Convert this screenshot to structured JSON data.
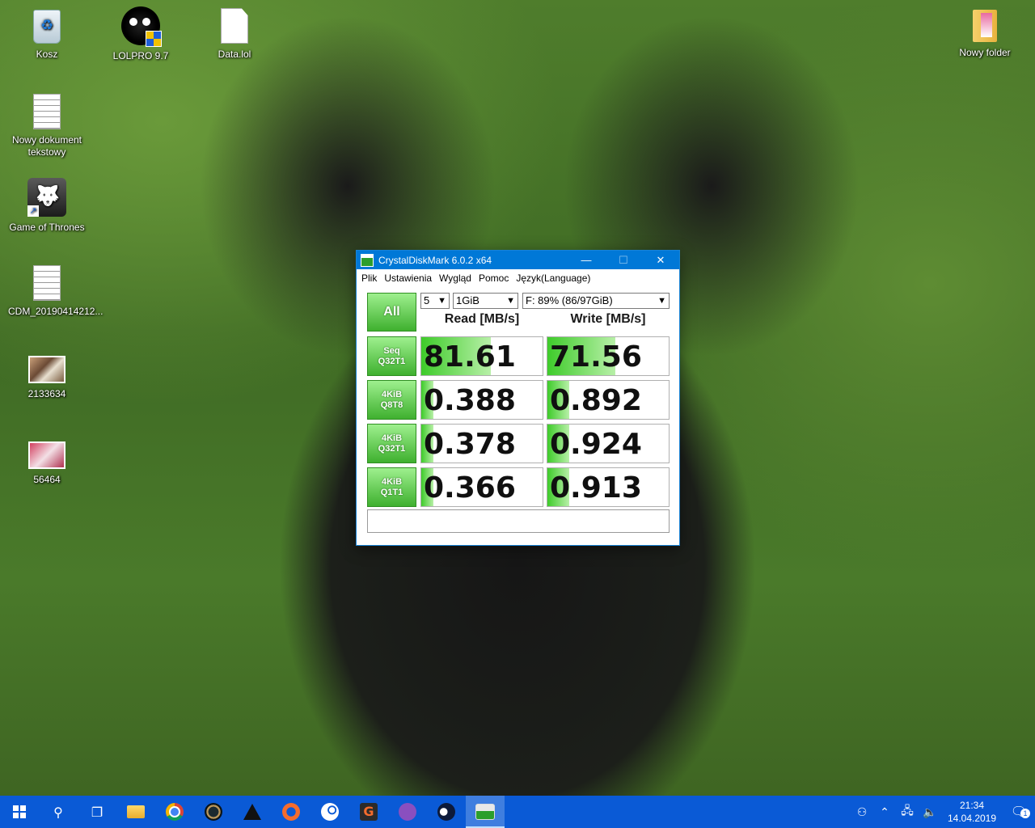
{
  "desktop": {
    "icons": [
      {
        "label": "Kosz",
        "icon": "recycle-bin-icon"
      },
      {
        "label": "LOLPRO 9.7",
        "icon": "lolpro-icon"
      },
      {
        "label": "Data.lol",
        "icon": "file-icon"
      },
      {
        "label": "Nowy folder",
        "icon": "folder-icon"
      },
      {
        "label": "Nowy dokument tekstowy",
        "icon": "text-document-icon"
      },
      {
        "label": "Game of Thrones",
        "icon": "shortcut-icon"
      },
      {
        "label": "CDM_20190414212...",
        "icon": "text-document-icon"
      },
      {
        "label": "2133634",
        "icon": "image-icon"
      },
      {
        "label": "56464",
        "icon": "image-icon"
      }
    ]
  },
  "window": {
    "title": "CrystalDiskMark 6.0.2 x64",
    "min_glyph": "—",
    "max_glyph": "☐",
    "close_glyph": "✕",
    "menu": [
      "Plik",
      "Ustawienia",
      "Wygląd",
      "Pomoc",
      "Język(Language)"
    ],
    "all_label": "All",
    "count": "5",
    "size": "1GiB",
    "drive": "F: 89% (86/97GiB)",
    "read_header": "Read [MB/s]",
    "write_header": "Write [MB/s]",
    "tests": [
      {
        "line1": "Seq",
        "line2": "Q32T1",
        "read": "81.61",
        "write": "71.56",
        "read_frac": 0.57,
        "write_frac": 0.56
      },
      {
        "line1": "4KiB",
        "line2": "Q8T8",
        "read": "0.388",
        "write": "0.892",
        "read_frac": 0.1,
        "write_frac": 0.18
      },
      {
        "line1": "4KiB",
        "line2": "Q32T1",
        "read": "0.378",
        "write": "0.924",
        "read_frac": 0.1,
        "write_frac": 0.18
      },
      {
        "line1": "4KiB",
        "line2": "Q1T1",
        "read": "0.366",
        "write": "0.913",
        "read_frac": 0.1,
        "write_frac": 0.18
      }
    ],
    "comment": ""
  },
  "taskbar": {
    "clock_time": "21:34",
    "clock_date": "14.04.2019",
    "notification_count": "1"
  }
}
